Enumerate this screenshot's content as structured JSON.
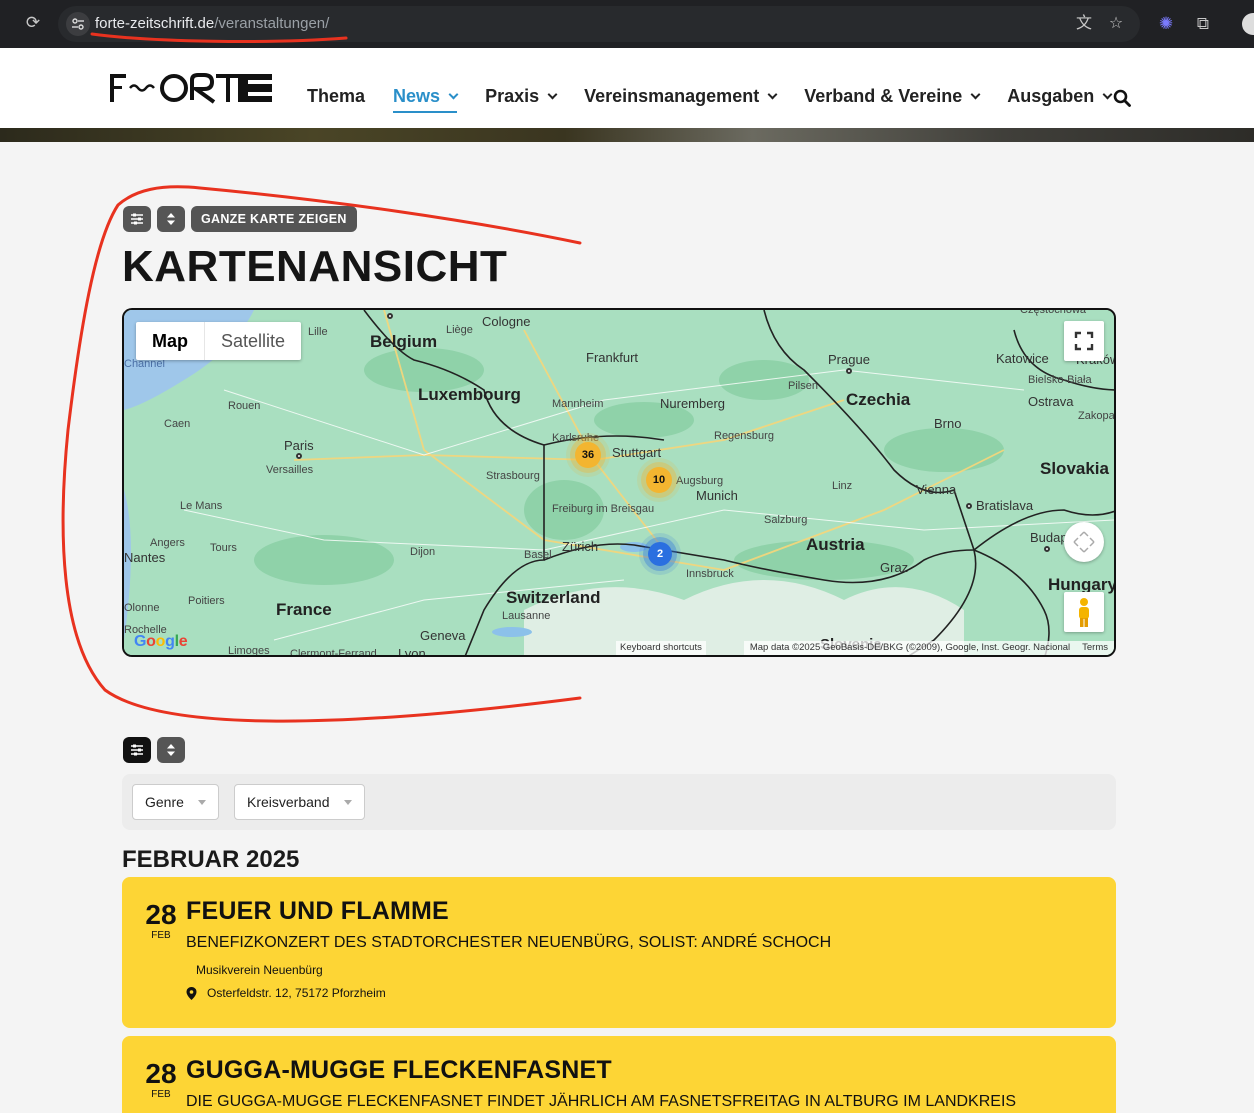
{
  "browser": {
    "url_host": "forte-zeitschrift.de",
    "url_path": "/veranstaltungen/"
  },
  "header": {
    "nav": [
      {
        "label": "Thema",
        "dropdown": false
      },
      {
        "label": "News",
        "dropdown": true,
        "active": true
      },
      {
        "label": "Praxis",
        "dropdown": true
      },
      {
        "label": "Vereinsmanagement",
        "dropdown": true
      },
      {
        "label": "Verband & Vereine",
        "dropdown": true
      },
      {
        "label": "Ausgaben",
        "dropdown": true
      }
    ],
    "accent_color": "#2a8fc9"
  },
  "map_section": {
    "show_full_map_label": "GANZE KARTE ZEIGEN",
    "title": "KARTENANSICHT",
    "map_type_options": [
      "Map",
      "Satellite"
    ],
    "map_type_selected": "Map",
    "clusters": [
      {
        "count": "36",
        "color": "yellow"
      },
      {
        "count": "10",
        "color": "yellow"
      },
      {
        "count": "2",
        "color": "blue"
      }
    ],
    "labels": {
      "countries": [
        "Belgium",
        "Luxembourg",
        "Czechia",
        "Slovakia",
        "Austria",
        "Switzerland",
        "France",
        "Hungary"
      ],
      "cities": [
        "Cologne",
        "Liège",
        "Lille",
        "Frankfurt",
        "Prague",
        "Katowice",
        "Kraków",
        "Pilsen",
        "Mannheim",
        "Nuremberg",
        "Bielsko-Biała",
        "Ostrava",
        "Rouen",
        "Caen",
        "Karlsruhe",
        "Stuttgart",
        "Regensburg",
        "Brno",
        "Zakopane",
        "Paris",
        "Versailles",
        "Strasbourg",
        "Augsburg",
        "Munich",
        "Linz",
        "Vienna",
        "Bratislava",
        "Le Mans",
        "Freiburg im Breisgau",
        "Salzburg",
        "Angers",
        "Tours",
        "Dijon",
        "Basel",
        "Zürich",
        "Budapest",
        "Innsbruck",
        "Graz",
        "Nantes",
        "Poitiers",
        "Olonne",
        "Rochelle",
        "Lausanne",
        "Geneva",
        "Limoges",
        "Clermont-Ferrand",
        "Lyon",
        "Slovenia",
        "Channel",
        "Częstochowa"
      ]
    },
    "attribution": {
      "keyboard": "Keyboard shortcuts",
      "data": "Map data ©2025 GeoBasis-DE/BKG (©2009), Google, Inst. Geogr. Nacional",
      "terms": "Terms"
    },
    "google_logo": "Google"
  },
  "filters": {
    "genre_label": "Genre",
    "kreisverband_label": "Kreisverband"
  },
  "events_month": "FEBRUAR 2025",
  "events": [
    {
      "day": "28",
      "month": "FEB",
      "title": "FEUER UND FLAMME",
      "subtitle": "BENEFIZKONZERT DES STADTORCHESTER NEUENBÜRG, SOLIST: ANDRÉ SCHOCH",
      "organizer": "Musikverein Neuenbürg",
      "location": "Osterfeldstr. 12, 75172 Pforzheim"
    },
    {
      "day": "28",
      "month": "FEB",
      "title": "GUGGA-MUGGE FLECKENFASNET",
      "subtitle": "DIE GUGGA-MUGGE FLECKENFASNET FINDET JÄHRLICH AM FASNETSFREITAG IN ALTBURG IM LANDKREIS"
    }
  ],
  "colors": {
    "event_card": "#fdd535",
    "annotation_red": "#e8321f",
    "map_land": "#a9dfc0"
  }
}
